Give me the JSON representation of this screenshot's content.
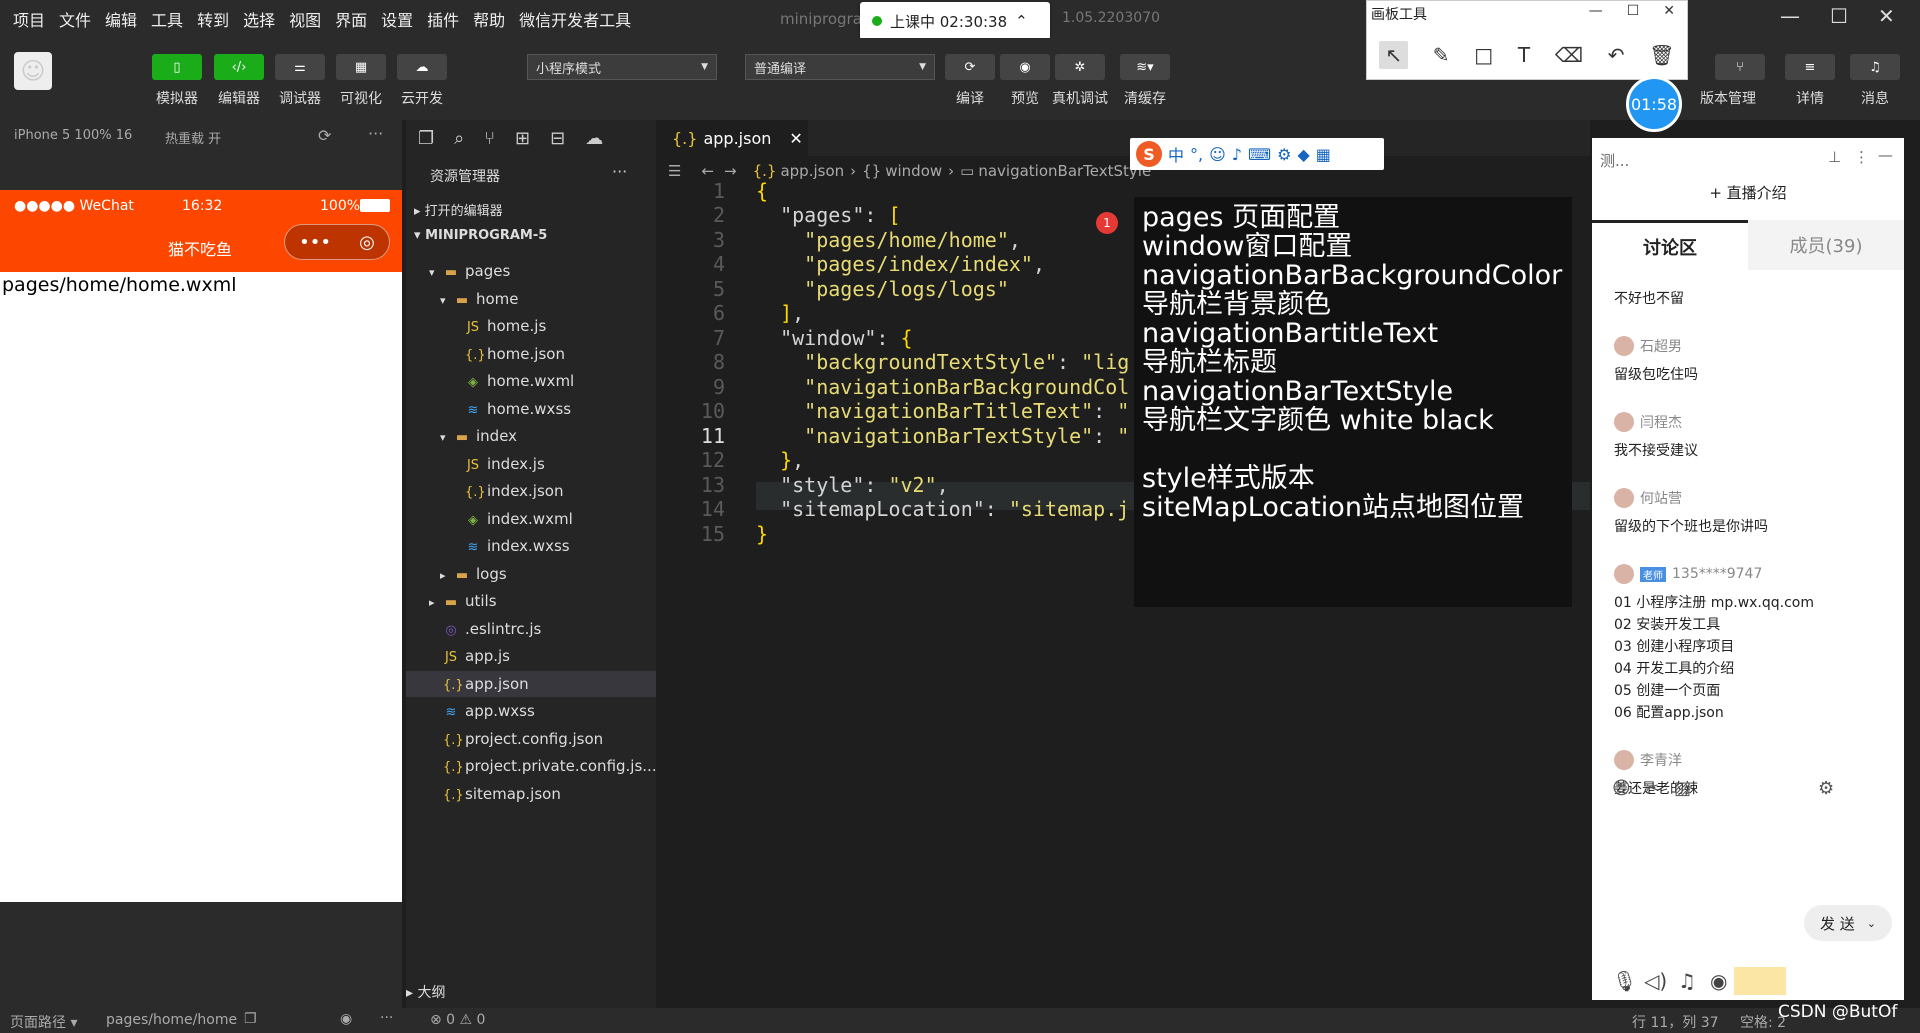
{
  "menubar": {
    "items": [
      "项目",
      "文件",
      "编辑",
      "工具",
      "转到",
      "选择",
      "视图",
      "界面",
      "设置",
      "插件",
      "帮助",
      "微信开发者工具"
    ],
    "window_title": "miniprogra",
    "version": "1.05.2203070",
    "class_status": "上课中 02:30:38"
  },
  "toolbar": {
    "simulator": "模拟器",
    "editor": "编辑器",
    "debugger": "调试器",
    "visual": "可视化",
    "cloud": "云开发",
    "mode_select": "小程序模式",
    "compile_select": "普通编译",
    "compile": "编译",
    "preview": "预览",
    "device_debug": "真机调试",
    "clear_cache": "清缓存",
    "version_mgmt": "版本管理",
    "details": "详情",
    "messages": "消息"
  },
  "draw_panel": {
    "title": "画板工具",
    "timer": "01:58"
  },
  "simulator": {
    "device": "iPhone 5 100% 16",
    "hot_reload": "热重载 开",
    "carrier": "●●●●● WeChat",
    "time": "16:32",
    "battery": "100%",
    "nav_title": "猫不吃鱼",
    "page_text": "pages/home/home.wxml"
  },
  "explorer": {
    "title": "资源管理器",
    "open_editors": "打开的编辑器",
    "project": "MINIPROGRAM-5",
    "outline": "大纲",
    "items": [
      {
        "label": "pages",
        "indent": 1,
        "icon": "folder-icon",
        "arrow": "▾"
      },
      {
        "label": "home",
        "indent": 2,
        "icon": "folder-icon",
        "arrow": "▾"
      },
      {
        "label": "home.js",
        "indent": 3,
        "icon": "js-icon",
        "arrow": ""
      },
      {
        "label": "home.json",
        "indent": 3,
        "icon": "json-icon",
        "arrow": ""
      },
      {
        "label": "home.wxml",
        "indent": 3,
        "icon": "wxml-icon",
        "arrow": ""
      },
      {
        "label": "home.wxss",
        "indent": 3,
        "icon": "wxss-icon",
        "arrow": ""
      },
      {
        "label": "index",
        "indent": 2,
        "icon": "folder-icon",
        "arrow": "▾"
      },
      {
        "label": "index.js",
        "indent": 3,
        "icon": "js-icon",
        "arrow": ""
      },
      {
        "label": "index.json",
        "indent": 3,
        "icon": "json-icon",
        "arrow": ""
      },
      {
        "label": "index.wxml",
        "indent": 3,
        "icon": "wxml-icon",
        "arrow": ""
      },
      {
        "label": "index.wxss",
        "indent": 3,
        "icon": "wxss-icon",
        "arrow": ""
      },
      {
        "label": "logs",
        "indent": 2,
        "icon": "folder-icon",
        "arrow": "▸"
      },
      {
        "label": "utils",
        "indent": 1,
        "icon": "folder-icon",
        "arrow": "▸"
      },
      {
        "label": ".eslintrc.js",
        "indent": 1,
        "icon": "eslint-icon",
        "arrow": ""
      },
      {
        "label": "app.js",
        "indent": 1,
        "icon": "js-icon",
        "arrow": ""
      },
      {
        "label": "app.json",
        "indent": 1,
        "icon": "json-icon",
        "arrow": "",
        "selected": true
      },
      {
        "label": "app.wxss",
        "indent": 1,
        "icon": "wxss-icon",
        "arrow": ""
      },
      {
        "label": "project.config.json",
        "indent": 1,
        "icon": "json-icon",
        "arrow": ""
      },
      {
        "label": "project.private.config.js...",
        "indent": 1,
        "icon": "json-icon",
        "arrow": ""
      },
      {
        "label": "sitemap.json",
        "indent": 1,
        "icon": "json-icon",
        "arrow": ""
      }
    ]
  },
  "editor": {
    "tab": "app.json",
    "breadcrumb": [
      "app.json",
      "window",
      "navigationBarTextStyle"
    ],
    "current_line": 11,
    "lines": [
      [
        {
          "t": "{",
          "c": "br"
        }
      ],
      [
        {
          "t": "  \"pages\"",
          "c": "k"
        },
        {
          "t": ": ",
          "c": "k"
        },
        {
          "t": "[",
          "c": "br"
        }
      ],
      [
        {
          "t": "    \"pages/home/home\"",
          "c": "s"
        },
        {
          "t": ",",
          "c": "k"
        }
      ],
      [
        {
          "t": "    \"pages/index/index\"",
          "c": "s"
        },
        {
          "t": ",",
          "c": "k"
        }
      ],
      [
        {
          "t": "    \"pages/logs/logs\"",
          "c": "s"
        }
      ],
      [
        {
          "t": "  ]",
          "c": "br"
        },
        {
          "t": ",",
          "c": "k"
        }
      ],
      [
        {
          "t": "  \"window\"",
          "c": "k"
        },
        {
          "t": ": ",
          "c": "k"
        },
        {
          "t": "{",
          "c": "br"
        }
      ],
      [
        {
          "t": "    \"backgroundTextStyle\"",
          "c": "s"
        },
        {
          "t": ": ",
          "c": "k"
        },
        {
          "t": "\"lig",
          "c": "s"
        }
      ],
      [
        {
          "t": "    \"navigationBarBackgroundCol",
          "c": "s"
        }
      ],
      [
        {
          "t": "    \"navigationBarTitleText\"",
          "c": "s"
        },
        {
          "t": ": ",
          "c": "k"
        },
        {
          "t": "\"",
          "c": "s"
        }
      ],
      [
        {
          "t": "    \"navigationBarTextStyle\"",
          "c": "s"
        },
        {
          "t": ": ",
          "c": "k"
        },
        {
          "t": "\"",
          "c": "s"
        }
      ],
      [
        {
          "t": "  }",
          "c": "br"
        },
        {
          "t": ",",
          "c": "k"
        }
      ],
      [
        {
          "t": "  \"style\"",
          "c": "k"
        },
        {
          "t": ": ",
          "c": "k"
        },
        {
          "t": "\"v2\"",
          "c": "s"
        },
        {
          "t": ",",
          "c": "k"
        }
      ],
      [
        {
          "t": "  \"sitemapLocation\"",
          "c": "k"
        },
        {
          "t": ": ",
          "c": "k"
        },
        {
          "t": "\"sitemap.j",
          "c": "s"
        }
      ],
      [
        {
          "t": "}",
          "c": "br"
        }
      ]
    ]
  },
  "overlay": {
    "badge": "1",
    "lines": [
      "pages 页面配置",
      "window窗口配置",
      "navigationBarBackgroundColor",
      "导航栏背景颜色",
      "navigationBartitleText",
      "导航栏标题",
      "navigationBarTextStyle",
      "导航栏文字颜色 white black",
      "",
      "style样式版本",
      "siteMapLocation站点地图位置"
    ]
  },
  "ime": {
    "logo": "S",
    "lang": "中"
  },
  "chat": {
    "search": "测...",
    "live_intro": "+ 直播介绍",
    "tab_discuss": "讨论区",
    "tab_members": "成员(39)",
    "messages": [
      {
        "who": "",
        "text": "不好也不留"
      },
      {
        "who": "石超男",
        "text": "留级包吃住吗"
      },
      {
        "who": "闫程杰",
        "text": "我不接受建议"
      },
      {
        "who": "何站营",
        "text": "留级的下个班也是你讲吗"
      },
      {
        "who": "135****9747",
        "tag": "老师",
        "text": "01 小程序注册 mp.wx.qq.com\n02 安装开发工具\n03 创建小程序项目\n04 开发工具的介绍\n05 创建一个页面\n06 配置app.json"
      },
      {
        "who": "李青洋",
        "text": "姜还是老的辣"
      }
    ],
    "send": "发 送"
  },
  "statusbar": {
    "page_path_label": "页面路径",
    "page_path": "pages/home/home",
    "errors": "⊗ 0 ⚠ 0",
    "position": "行 11，列 37",
    "spaces": "空格: 2",
    "watermark": "CSDN @ButOf"
  },
  "colors": {
    "accent": "#1aad19",
    "phone_nav": "#fd4600"
  }
}
